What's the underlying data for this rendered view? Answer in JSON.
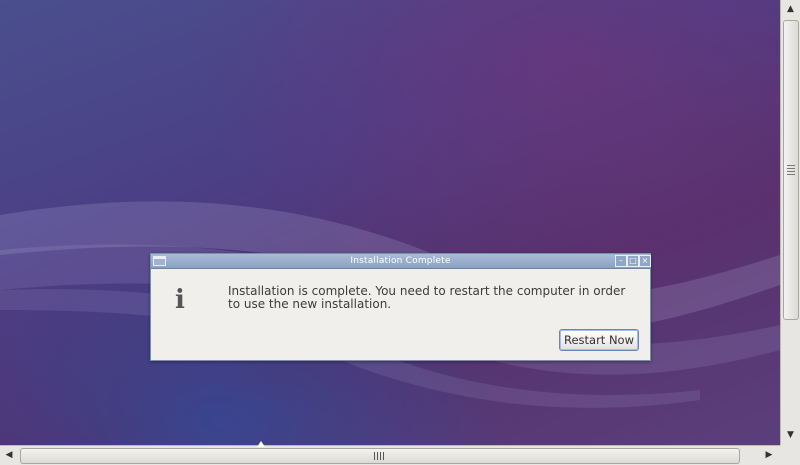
{
  "dialog": {
    "title": "Installation Complete",
    "message": "Installation is complete. You need to restart the computer in order to use the new installation.",
    "restart_label": "Restart Now",
    "info_glyph": "i",
    "controls": {
      "minimize": "–",
      "maximize": "□",
      "close": "×"
    }
  },
  "scrollbars": {
    "up_arrow": "▲",
    "down_arrow": "▼",
    "left_arrow": "◀",
    "right_arrow": "▶"
  },
  "colors": {
    "titlebar": "#8aa1c2",
    "dialog_bg": "#f0efec",
    "desktop_purple": "#57306c",
    "desktop_blue": "#3a5aa0"
  }
}
